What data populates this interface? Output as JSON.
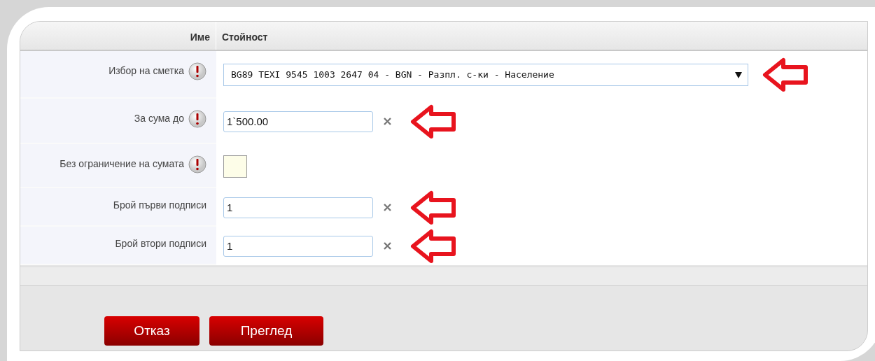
{
  "table": {
    "columns": [
      "Име",
      "Стойност"
    ],
    "rows": [
      {
        "kind": "select",
        "label": "Избор на сметка",
        "info": true,
        "value": "BG89 TEXI 9545 1003 2647 04 - BGN - Разпл. с-ки - Население",
        "arrow": true
      },
      {
        "kind": "text",
        "label": "За сума до",
        "info": true,
        "value": "1`500.00",
        "arrow": true
      },
      {
        "kind": "checkbox",
        "label": "Без ограничение на сумата",
        "info": true,
        "checked": false,
        "arrow": false
      },
      {
        "kind": "text",
        "label": "Брой първи подписи",
        "info": false,
        "value": "1",
        "arrow": true
      },
      {
        "kind": "text",
        "label": "Брой втори подписи",
        "info": false,
        "value": "1",
        "arrow": true
      }
    ]
  },
  "buttons": [
    {
      "label": "Отказ"
    },
    {
      "label": "Преглед"
    }
  ]
}
